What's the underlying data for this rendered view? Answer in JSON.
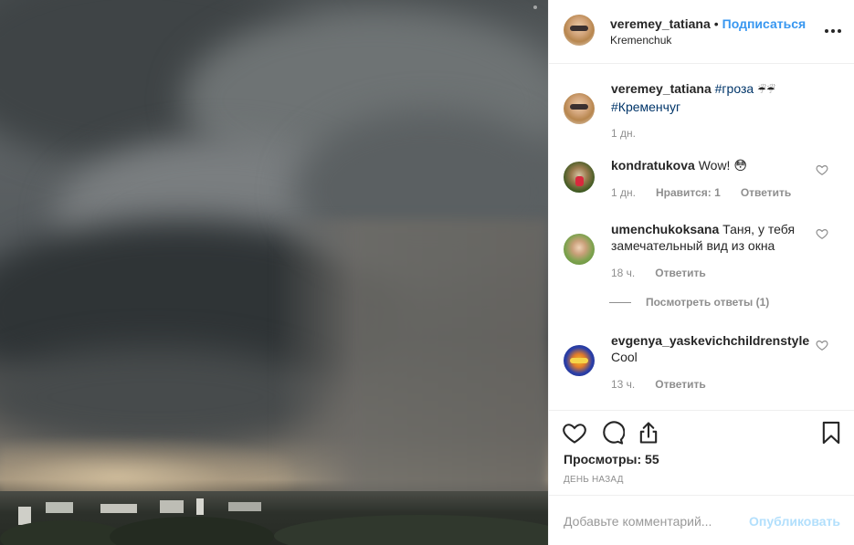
{
  "post": {
    "owner_username": "veremey_tatiana",
    "separator": "•",
    "follow_label": "Подписаться",
    "location": "Kremenchuk"
  },
  "caption": {
    "username": "veremey_tatiana",
    "hashtag1": "#гроза",
    "emoji": "☔☔",
    "hashtag2": "#Кременчуг",
    "time": "1 дн."
  },
  "comments": [
    {
      "username": "kondratukova",
      "text": "Wow! 😳",
      "time": "1 дн.",
      "likes": "Нравится: 1",
      "reply": "Ответить"
    },
    {
      "username": "umenchukoksana",
      "text": "Таня, у тебя замечательный вид из окна",
      "time": "18 ч.",
      "reply": "Ответить",
      "view_replies": "Посмотреть ответы (1)"
    },
    {
      "username": "evgenya_yaskevichchildrenstyle",
      "text": "Cool",
      "time": "13 ч.",
      "reply": "Ответить"
    }
  ],
  "actions": {
    "views": "Просмотры: 55",
    "posted": "ДЕНЬ НАЗАД"
  },
  "add_comment": {
    "placeholder": "Добавьте комментарий...",
    "publish_label": "Опубликовать"
  },
  "colors": {
    "link_blue": "#3897f0",
    "hashtag": "#003569",
    "muted": "#8e8e8e",
    "publish_disabled": "#b2dffc"
  }
}
